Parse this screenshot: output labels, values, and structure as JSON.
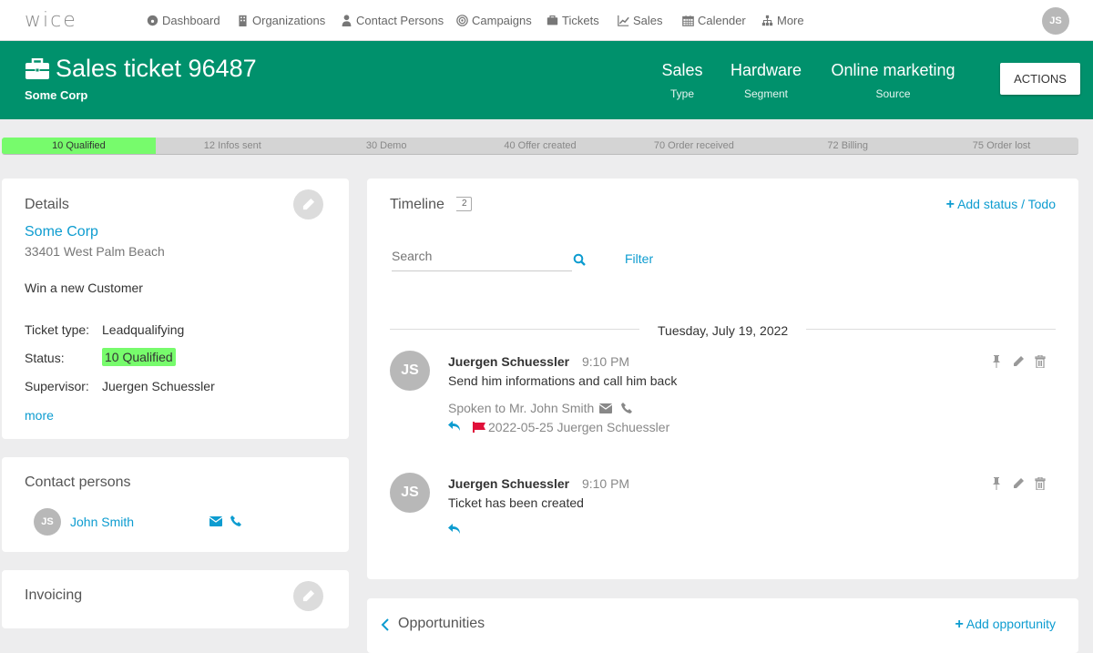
{
  "app": {
    "logo": "wice"
  },
  "nav": {
    "items": [
      {
        "label": "Dashboard",
        "icon": "dashboard-icon"
      },
      {
        "label": "Organizations",
        "icon": "building-icon"
      },
      {
        "label": "Contact Persons",
        "icon": "user-icon"
      },
      {
        "label": "Campaigns",
        "icon": "target-icon"
      },
      {
        "label": "Tickets",
        "icon": "briefcase-icon"
      },
      {
        "label": "Sales",
        "icon": "line-chart-icon"
      },
      {
        "label": "Calender",
        "icon": "calendar-icon"
      },
      {
        "label": "More",
        "icon": "sitemap-icon"
      }
    ],
    "user_initials": "JS"
  },
  "header": {
    "title": "Sales ticket 96487",
    "company": "Some Corp",
    "fields": [
      {
        "value": "Sales",
        "label": "Type"
      },
      {
        "value": "Hardware",
        "label": "Segment"
      },
      {
        "value": "Online marketing",
        "label": "Source"
      }
    ],
    "actions_label": "ACTIONS",
    "color": "#00916c"
  },
  "pipeline": {
    "stages": [
      "10 Qualified",
      "12 Infos sent",
      "30 Demo",
      "40 Offer created",
      "70 Order received",
      "72 Billing",
      "75 Order lost"
    ],
    "active_index": 0,
    "active_color": "#77fb6c"
  },
  "details": {
    "title": "Details",
    "company": "Some Corp",
    "address": "33401 West Palm Beach",
    "description": "Win a new Customer",
    "ticket_type_label": "Ticket type:",
    "ticket_type": "Leadqualifying",
    "status_label": "Status:",
    "status": "10 Qualified",
    "supervisor_label": "Supervisor:",
    "supervisor": "Juergen Schuessler",
    "more": "more"
  },
  "contacts": {
    "title": "Contact persons",
    "items": [
      {
        "initials": "JS",
        "name": "John Smith"
      }
    ]
  },
  "invoicing": {
    "title": "Invoicing"
  },
  "timeline": {
    "title": "Timeline",
    "count": "2",
    "add_label": "Add status / Todo",
    "search_placeholder": "Search",
    "filter_label": "Filter",
    "date": "Tuesday, July 19, 2022",
    "entries": [
      {
        "initials": "JS",
        "author": "Juergen Schuessler",
        "time": "9:10 PM",
        "text": "Send him informations and call him back",
        "note": "Spoken to Mr. John Smith",
        "flag": "2022-05-25 Juergen Schuessler"
      },
      {
        "initials": "JS",
        "author": "Juergen Schuessler",
        "time": "9:10 PM",
        "text": "Ticket has been created"
      }
    ]
  },
  "opportunities": {
    "title": "Opportunities",
    "add_label": "Add opportunity"
  },
  "colors": {
    "link": "#0d9cd0",
    "flag": "#e0103a"
  }
}
